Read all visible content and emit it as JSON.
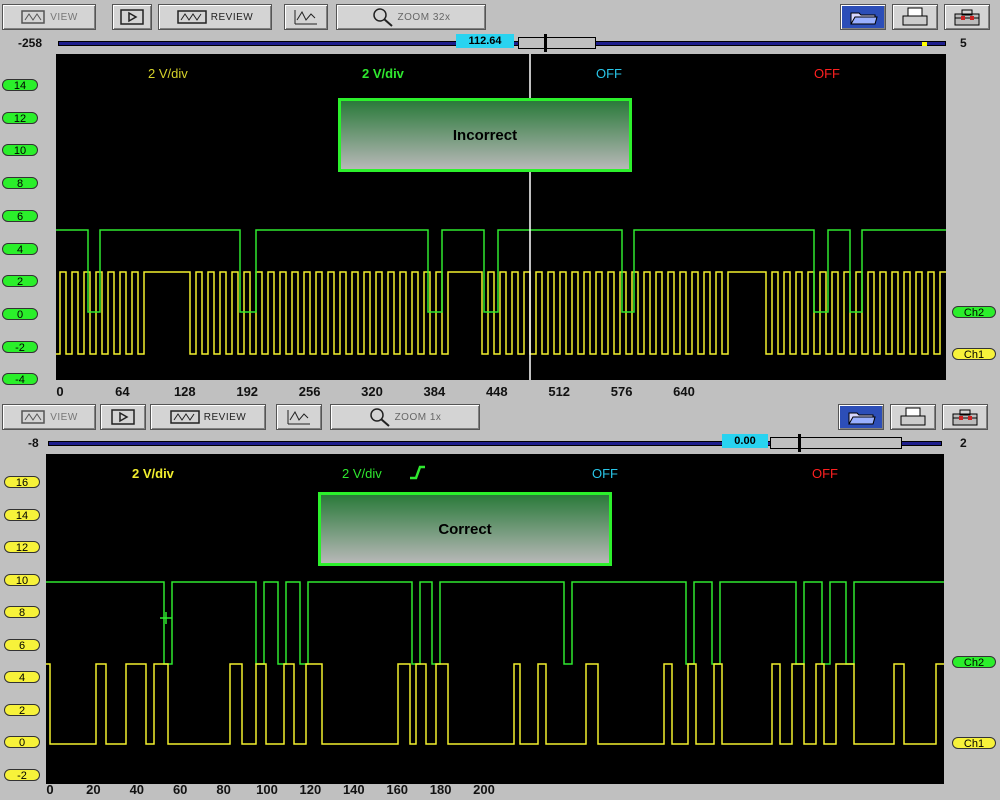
{
  "toolbar": {
    "view_label": "VIEW",
    "review_label": "REVIEW",
    "zoom_label_top": "ZOOM 32x",
    "zoom_label_bottom": "ZOOM 1x"
  },
  "top": {
    "scroll_left": "-258",
    "scroll_right": "5",
    "cursor_value": "112.64",
    "banner": "Incorrect",
    "ch1_div": "2 V/div",
    "ch2_div": "2 V/div",
    "ch3": "OFF",
    "ch4": "OFF",
    "y_ticks": [
      "14",
      "12",
      "10",
      "8",
      "6",
      "4",
      "2",
      "0",
      "-2",
      "-4"
    ],
    "x_ticks": [
      "0",
      "64",
      "128",
      "192",
      "256",
      "320",
      "384",
      "448",
      "512",
      "576",
      "640"
    ],
    "ch2_tag": "Ch2",
    "ch1_tag": "Ch1"
  },
  "bottom": {
    "scroll_left": "-8",
    "scroll_right": "2",
    "cursor_value": "0.00",
    "banner": "Correct",
    "ch1_div": "2 V/div",
    "ch2_div": "2 V/div",
    "ch3": "OFF",
    "ch4": "OFF",
    "y_ticks": [
      "16",
      "14",
      "12",
      "10",
      "8",
      "6",
      "4",
      "2",
      "0",
      "-2"
    ],
    "x_ticks": [
      "0",
      "20",
      "40",
      "60",
      "80",
      "100",
      "120",
      "140",
      "160",
      "180",
      "200"
    ],
    "ch2_tag": "Ch2",
    "ch1_tag": "Ch1"
  },
  "colors": {
    "ch1": "#f2ef2e",
    "ch2": "#2fe82f",
    "ch3": "#29c6e8",
    "ch4": "#ff2020",
    "grid_bg": "#000000"
  },
  "icons": [
    "view-icon",
    "play-icon",
    "review-icon",
    "trace-icon",
    "zoom-icon",
    "folder-icon",
    "print-icon",
    "toolbox-icon"
  ]
}
